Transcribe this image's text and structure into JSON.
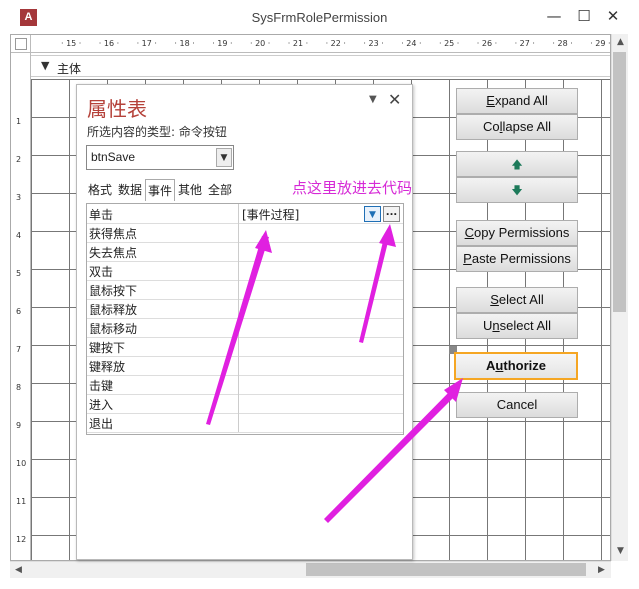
{
  "window": {
    "title": "SysFrmRolePermission",
    "app_icon_text": "A",
    "minimize": "—",
    "maximize": "☐",
    "close": "✕"
  },
  "ruler": {
    "h_ticks": [
      "15",
      "16",
      "17",
      "18",
      "19",
      "20",
      "21",
      "22",
      "23",
      "24",
      "25",
      "26",
      "27",
      "28",
      "29"
    ],
    "v_ticks": [
      "1",
      "2",
      "3",
      "4",
      "5",
      "6",
      "7",
      "8",
      "9",
      "10",
      "11",
      "12"
    ],
    "inner_ticks": [
      "7",
      "17"
    ]
  },
  "section": {
    "label": "主体",
    "icon": "section-marker-icon"
  },
  "buttons": [
    {
      "id": "expand",
      "pre": "",
      "ul": "E",
      "post": "xpand All"
    },
    {
      "id": "collapse",
      "pre": "Co",
      "ul": "l",
      "post": "lapse All"
    },
    {
      "id": "up",
      "symbol": "🡅"
    },
    {
      "id": "down",
      "symbol": "🡇"
    },
    {
      "id": "copy",
      "pre": "",
      "ul": "C",
      "post": "opy Permissions"
    },
    {
      "id": "paste",
      "pre": "",
      "ul": "P",
      "post": "aste Permissions"
    },
    {
      "id": "select",
      "pre": "",
      "ul": "S",
      "post": "elect All"
    },
    {
      "id": "unselect",
      "pre": "U",
      "ul": "n",
      "post": "select All"
    },
    {
      "id": "authorize",
      "pre": "A",
      "ul": "u",
      "post": "thorize"
    },
    {
      "id": "cancel",
      "pre": "Cancel",
      "ul": "",
      "post": ""
    }
  ],
  "property_sheet": {
    "title": "属性表",
    "selection_type_label": "所选内容的类型: 命令按钮",
    "selected_control": "btnSave",
    "tabs": [
      "格式",
      "数据",
      "事件",
      "其他",
      "全部"
    ],
    "active_tab": "事件",
    "rows": [
      {
        "name": "单击",
        "value": "[事件过程]"
      },
      {
        "name": "获得焦点",
        "value": ""
      },
      {
        "name": "失去焦点",
        "value": ""
      },
      {
        "name": "双击",
        "value": ""
      },
      {
        "name": "鼠标按下",
        "value": ""
      },
      {
        "name": "鼠标释放",
        "value": ""
      },
      {
        "name": "鼠标移动",
        "value": ""
      },
      {
        "name": "键按下",
        "value": ""
      },
      {
        "name": "键释放",
        "value": ""
      },
      {
        "name": "击键",
        "value": ""
      },
      {
        "name": "进入",
        "value": ""
      },
      {
        "name": "退出",
        "value": ""
      }
    ],
    "builder_button": "...",
    "dropdown_icon": "chevron-down-icon"
  },
  "annotation": {
    "text": "点这里放进去代码",
    "color": "#d62ad6"
  },
  "colors": {
    "accent_title": "#b5423a",
    "highlight_border": "#f5a623",
    "arrow": "#e020e0"
  }
}
